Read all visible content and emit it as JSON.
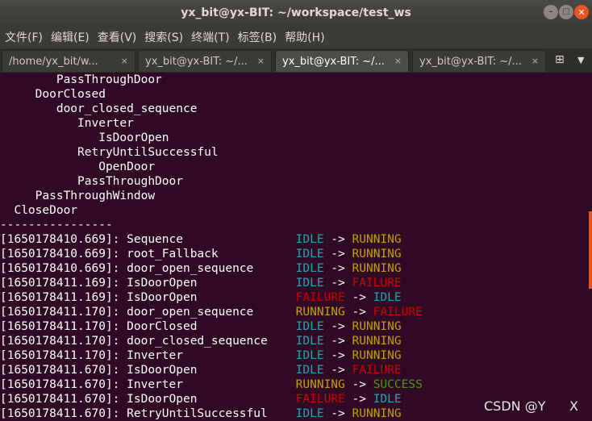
{
  "window": {
    "title": "yx_bit@yx-BIT: ~/workspace/test_ws",
    "minimize_glyph": "–",
    "maximize_glyph": "□",
    "close_glyph": "✕"
  },
  "menu": [
    "文件(F)",
    "编辑(E)",
    "查看(V)",
    "搜索(S)",
    "终端(T)",
    "标签(B)",
    "帮助(H)"
  ],
  "tabs": [
    {
      "label": "/home/yx_bit/w...",
      "active": false
    },
    {
      "label": "yx_bit@yx-BIT: ~/...",
      "active": false
    },
    {
      "label": "yx_bit@yx-BIT: ~/...",
      "active": true
    },
    {
      "label": "yx_bit@yx-BIT: ~/...",
      "active": false
    }
  ],
  "tab_close_glyph": "×",
  "new_tab_icon": "⊞",
  "tab_menu_icon": "▼",
  "tree_lines": [
    "        PassThroughDoor",
    "     DoorClosed",
    "        door_closed_sequence",
    "           Inverter",
    "              IsDoorOpen",
    "           RetryUntilSuccessful",
    "              OpenDoor",
    "           PassThroughDoor",
    "     PassThroughWindow",
    "  CloseDoor",
    "----------------"
  ],
  "log_lines": [
    {
      "prefix": "[1650178410.669]: Sequence                ",
      "from": "IDLE",
      "from_status": "idle",
      "to": "RUNNING",
      "to_status": "running"
    },
    {
      "prefix": "[1650178410.669]: root_Fallback           ",
      "from": "IDLE",
      "from_status": "idle",
      "to": "RUNNING",
      "to_status": "running"
    },
    {
      "prefix": "[1650178410.669]: door_open_sequence      ",
      "from": "IDLE",
      "from_status": "idle",
      "to": "RUNNING",
      "to_status": "running"
    },
    {
      "prefix": "[1650178411.169]: IsDoorOpen              ",
      "from": "IDLE",
      "from_status": "idle",
      "to": "FAILURE",
      "to_status": "failure"
    },
    {
      "prefix": "[1650178411.169]: IsDoorOpen              ",
      "from": "FAILURE",
      "from_status": "failure",
      "to": "IDLE",
      "to_status": "idle"
    },
    {
      "prefix": "[1650178411.170]: door_open_sequence      ",
      "from": "RUNNING",
      "from_status": "running",
      "to": "FAILURE",
      "to_status": "failure"
    },
    {
      "prefix": "[1650178411.170]: DoorClosed              ",
      "from": "IDLE",
      "from_status": "idle",
      "to": "RUNNING",
      "to_status": "running"
    },
    {
      "prefix": "[1650178411.170]: door_closed_sequence    ",
      "from": "IDLE",
      "from_status": "idle",
      "to": "RUNNING",
      "to_status": "running"
    },
    {
      "prefix": "[1650178411.170]: Inverter                ",
      "from": "IDLE",
      "from_status": "idle",
      "to": "RUNNING",
      "to_status": "running"
    },
    {
      "prefix": "[1650178411.670]: IsDoorOpen              ",
      "from": "IDLE",
      "from_status": "idle",
      "to": "FAILURE",
      "to_status": "failure"
    },
    {
      "prefix": "[1650178411.670]: Inverter                ",
      "from": "RUNNING",
      "from_status": "running",
      "to": "SUCCESS",
      "to_status": "success"
    },
    {
      "prefix": "[1650178411.670]: IsDoorOpen              ",
      "from": "FAILURE",
      "from_status": "failure",
      "to": "IDLE",
      "to_status": "idle"
    },
    {
      "prefix": "[1650178411.670]: RetryUntilSuccessful    ",
      "from": "IDLE",
      "from_status": "idle",
      "to": "RUNNING",
      "to_status": "running"
    }
  ],
  "arrow": " -> ",
  "colors": {
    "terminal_bg": "#300a24",
    "idle": "#2aa1b3",
    "running": "#c4a000",
    "failure": "#cc0000",
    "success": "#4e9a06",
    "accent": "#e95420"
  },
  "watermark": "CSDN @Y",
  "watermark_x": "X"
}
